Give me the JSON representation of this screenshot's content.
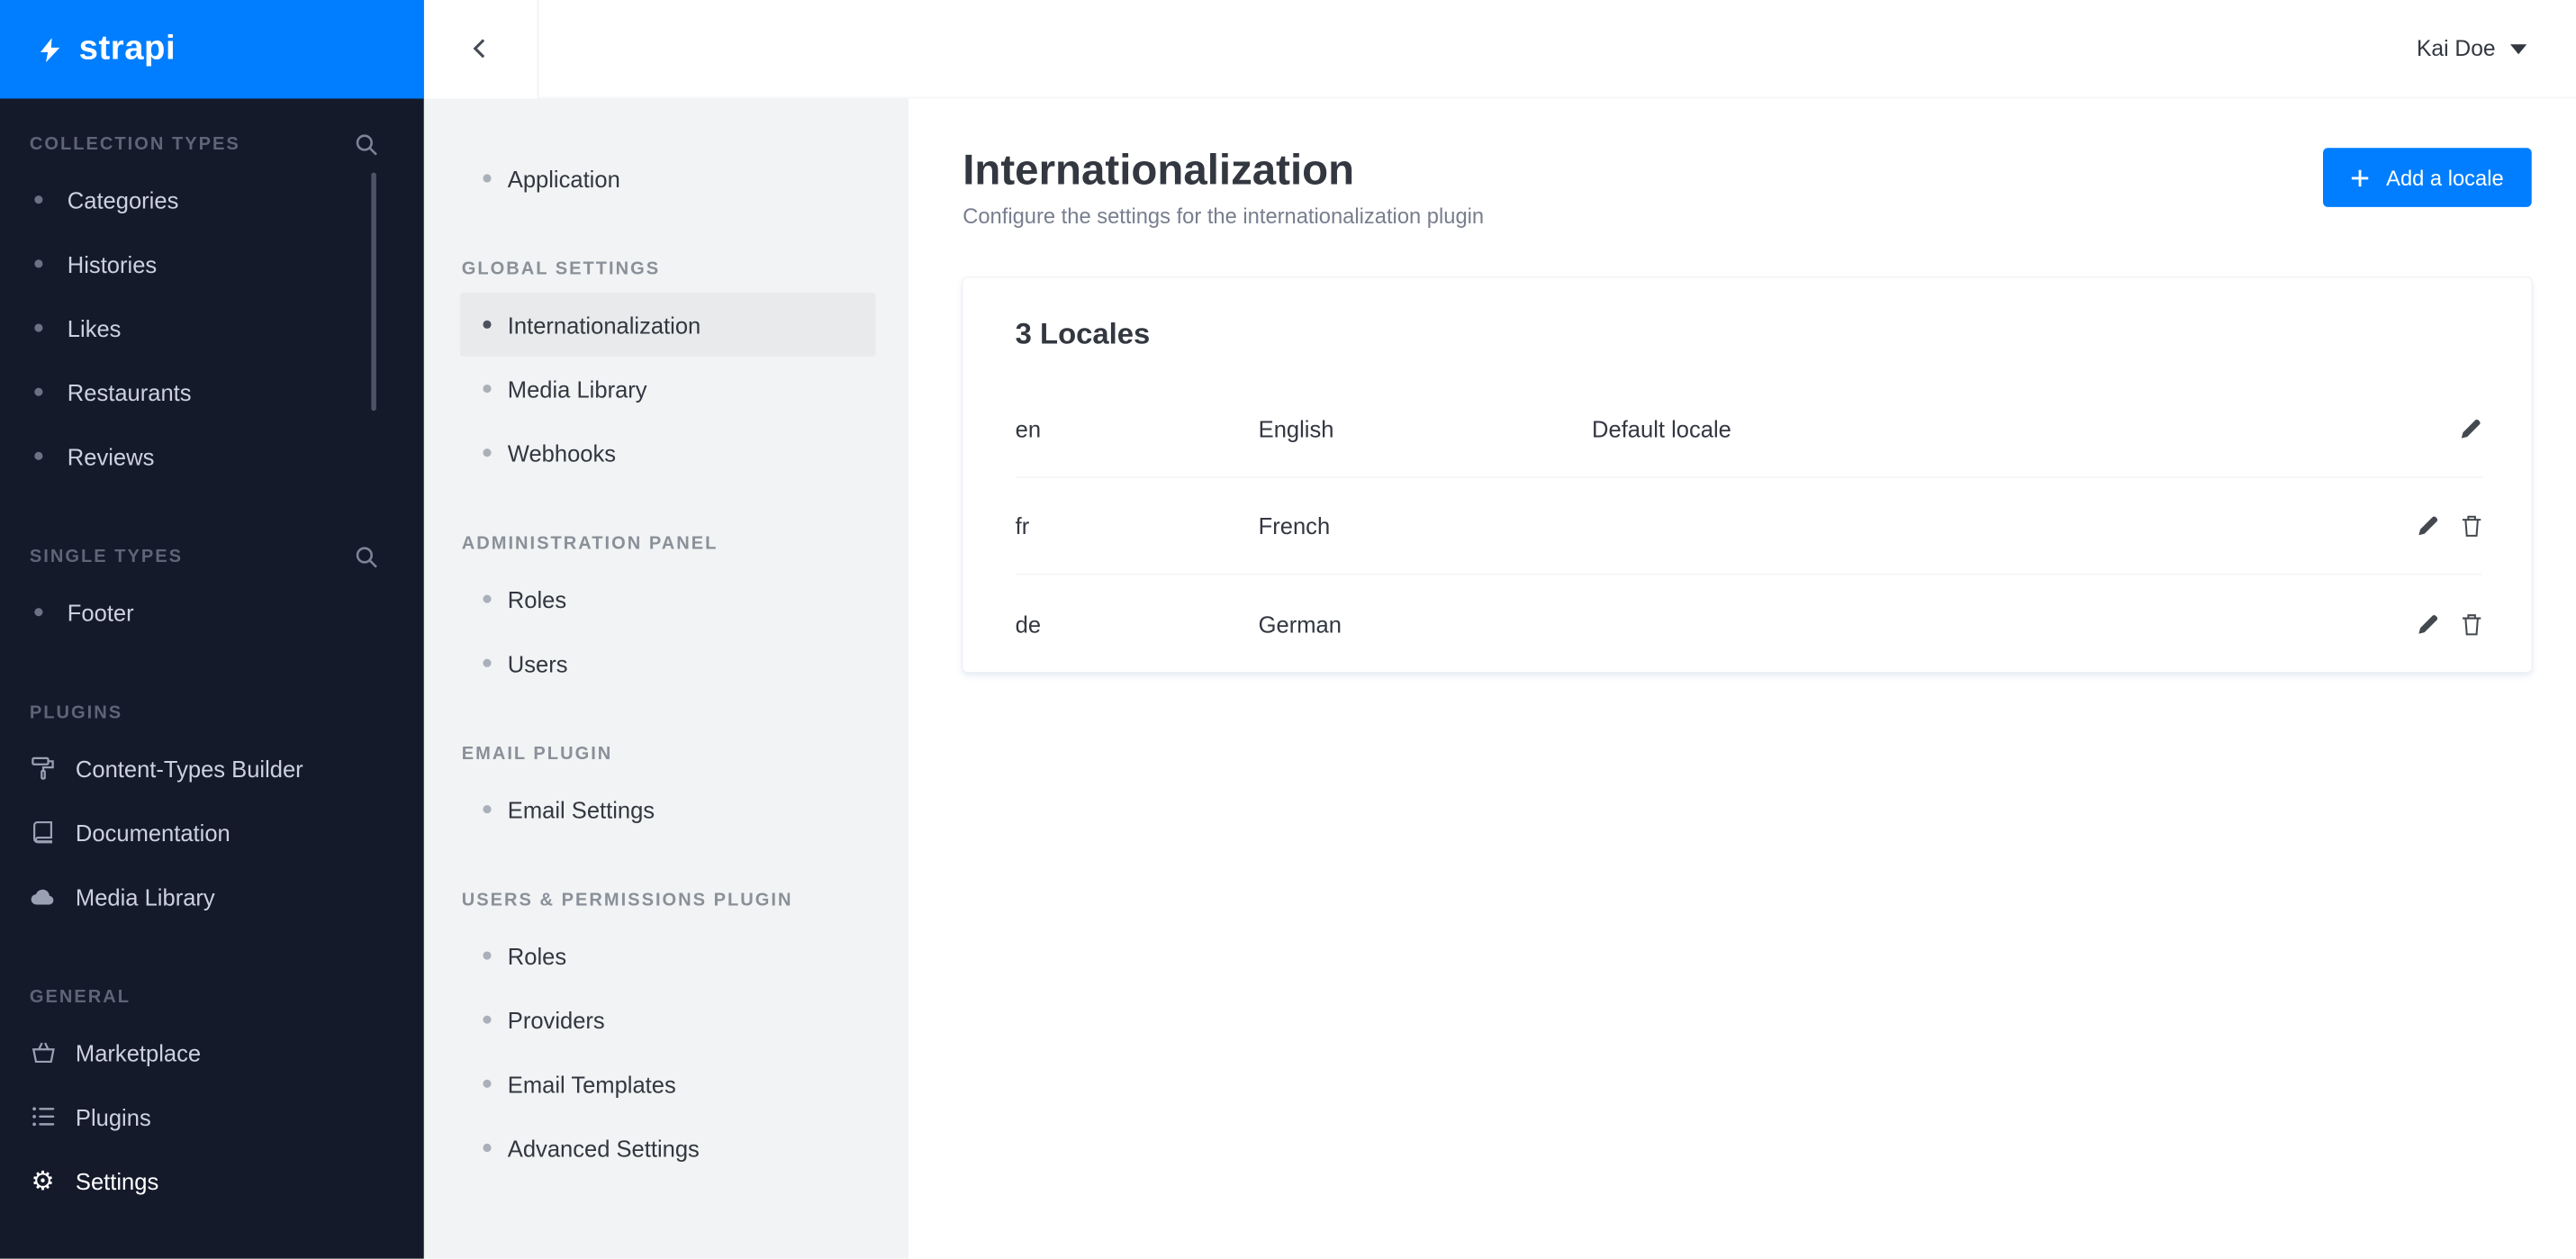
{
  "app": {
    "logo_text": "strapi"
  },
  "colors": {
    "brand_blue": "#007eff",
    "sidebar_bg": "#151a2b",
    "active_item_bg": "#e9eaeb"
  },
  "icons": {
    "gear": "⚙"
  },
  "topbar": {
    "user_name": "Kai Doe"
  },
  "sidebar": {
    "sections": [
      {
        "label": "COLLECTION TYPES",
        "has_search": true,
        "items": [
          {
            "label": "Categories"
          },
          {
            "label": "Histories"
          },
          {
            "label": "Likes"
          },
          {
            "label": "Restaurants"
          },
          {
            "label": "Reviews"
          }
        ]
      },
      {
        "label": "SINGLE TYPES",
        "has_search": true,
        "items": [
          {
            "label": "Footer"
          }
        ]
      },
      {
        "label": "PLUGINS",
        "items": [
          {
            "label": "Content-Types Builder",
            "icon": "roller-icon"
          },
          {
            "label": "Documentation",
            "icon": "book-icon"
          },
          {
            "label": "Media Library",
            "icon": "cloud-icon"
          }
        ]
      },
      {
        "label": "GENERAL",
        "items": [
          {
            "label": "Marketplace",
            "icon": "basket-icon"
          },
          {
            "label": "Plugins",
            "icon": "list-icon"
          },
          {
            "label": "Settings",
            "icon": "gear-icon",
            "active": true
          }
        ]
      }
    ]
  },
  "settings_nav": {
    "application": {
      "label": "Application"
    },
    "groups": [
      {
        "label": "GLOBAL SETTINGS",
        "items": [
          {
            "label": "Internationalization",
            "active": true
          },
          {
            "label": "Media Library"
          },
          {
            "label": "Webhooks"
          }
        ]
      },
      {
        "label": "ADMINISTRATION PANEL",
        "items": [
          {
            "label": "Roles"
          },
          {
            "label": "Users"
          }
        ]
      },
      {
        "label": "EMAIL PLUGIN",
        "items": [
          {
            "label": "Email Settings"
          }
        ]
      },
      {
        "label": "USERS & PERMISSIONS PLUGIN",
        "items": [
          {
            "label": "Roles"
          },
          {
            "label": "Providers"
          },
          {
            "label": "Email Templates"
          },
          {
            "label": "Advanced Settings"
          }
        ]
      }
    ]
  },
  "main": {
    "title": "Internationalization",
    "subtitle": "Configure the settings for the internationalization plugin",
    "add_button_label": "Add a locale",
    "card": {
      "title": "3 Locales",
      "rows": [
        {
          "code": "en",
          "name": "English",
          "note": "Default locale",
          "can_delete": false
        },
        {
          "code": "fr",
          "name": "French",
          "note": "",
          "can_delete": true
        },
        {
          "code": "de",
          "name": "German",
          "note": "",
          "can_delete": true
        }
      ]
    }
  }
}
